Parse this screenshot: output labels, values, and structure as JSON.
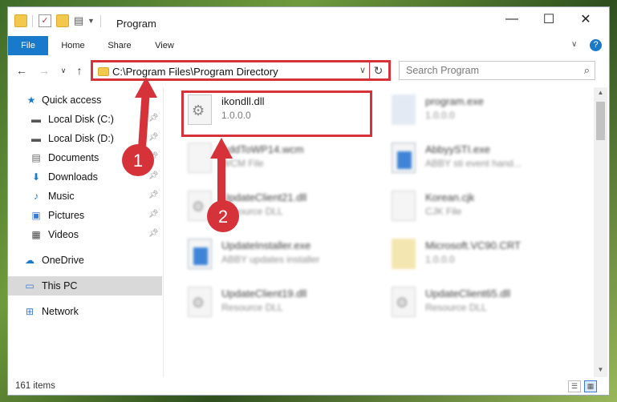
{
  "window": {
    "title": "Program",
    "controls": {
      "minimize": "—",
      "maximize": "☐",
      "close": "✕"
    }
  },
  "ribbon": {
    "tabs": [
      {
        "label": "File"
      },
      {
        "label": "Home"
      },
      {
        "label": "Share"
      },
      {
        "label": "View"
      }
    ],
    "collapse_icon": "chevron-down-icon",
    "help_icon": "?"
  },
  "address": {
    "path": "C:\\Program Files\\Program Directory",
    "chevron": "∨",
    "refresh": "↻"
  },
  "search": {
    "placeholder": "Search Program",
    "icon": "⌕"
  },
  "nav": {
    "items": [
      {
        "label": "Quick access",
        "icon": "star-icon"
      },
      {
        "label": "Local Disk (C:)",
        "icon": "drive-icon"
      },
      {
        "label": "Local Disk (D:)",
        "icon": "drive-icon"
      },
      {
        "label": "Documents",
        "icon": "documents-icon"
      },
      {
        "label": "Downloads",
        "icon": "download-icon"
      },
      {
        "label": "Music",
        "icon": "music-icon"
      },
      {
        "label": "Pictures",
        "icon": "pictures-icon"
      },
      {
        "label": "Videos",
        "icon": "videos-icon"
      },
      {
        "label": "OneDrive",
        "icon": "cloud-icon"
      },
      {
        "label": "This PC",
        "icon": "computer-icon"
      },
      {
        "label": "Network",
        "icon": "network-icon"
      }
    ]
  },
  "files": [
    {
      "name": "ikondll.dll",
      "sub": "1.0.0.0"
    },
    {
      "name": "program.exe",
      "sub": "1.0.0.0"
    },
    {
      "name": "AddToWP14.wcm",
      "sub": "WCM File"
    },
    {
      "name": "AbbyySTI.exe",
      "sub": "ABBY sti event hand..."
    },
    {
      "name": "UpdateClient21.dll",
      "sub": "Resource DLL"
    },
    {
      "name": "Korean.cjk",
      "sub": "CJK File"
    },
    {
      "name": "UpdateInstaller.exe",
      "sub": "ABBY updates installer"
    },
    {
      "name": "Microsoft.VC90.CRT",
      "sub": "1.0.0.0"
    },
    {
      "name": "UpdateClient19.dll",
      "sub": "Resource DLL"
    },
    {
      "name": "UpdateClient65.dll",
      "sub": "Resource DLL"
    }
  ],
  "status": {
    "items": "161 items"
  },
  "annotations": {
    "step1": "1",
    "step2": "2",
    "color": "#d6323a"
  }
}
